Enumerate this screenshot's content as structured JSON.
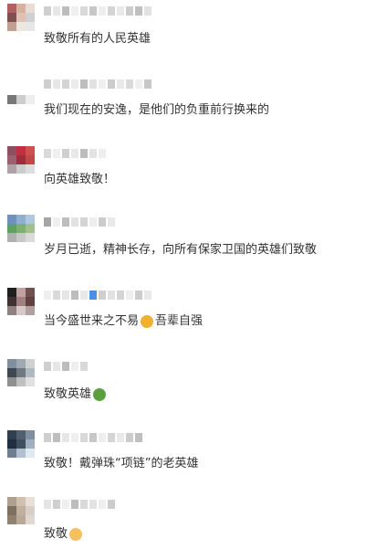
{
  "comments": [
    {
      "text": "致敬所有的人民英雄",
      "avatar": [
        "#b06060",
        "#d8b0a0",
        "#e8dcd4",
        "#805050",
        "#e0c0b0",
        "#d0d0d0",
        "#c0a090",
        "#ece8e0",
        "#e6e6e6"
      ],
      "name_blocks": [
        "#cfcfcf",
        "#e6e6e6",
        "#bdbdbd",
        "#efefef",
        "#d9d9d9",
        "#c7c7c7",
        "#eeeeee",
        "#d4d4d4",
        "#e9e9e9",
        "#cccccc",
        "#bfbfbf",
        "#e2e2e2"
      ]
    },
    {
      "text": "我们现在的安逸，是他们的负重前行换来的",
      "avatar": [
        "#ffffff",
        "#ffffff",
        "#ffffff",
        "#ffffff",
        "#ffffff",
        "#ffffff",
        "#777777",
        "#cccccc",
        "#eeeeee"
      ],
      "name_blocks": [
        "#cfcfcf",
        "#e6e6e6",
        "#d4d4d4",
        "#ececec",
        "#bdbdbd",
        "#e2e2e2",
        "#f0f0f0",
        "#cccccc",
        "#e9e9e9",
        "#d9d9d9",
        "#efefef",
        "#c7c7c7"
      ]
    },
    {
      "text": "向英雄致敬！",
      "avatar": [
        "#8a5060",
        "#c03040",
        "#d05050",
        "#9a6070",
        "#a02c3c",
        "#c04848",
        "#b0a0a8",
        "#cccccc",
        "#dddddd"
      ],
      "name_blocks": [
        "#d9d9d9",
        "#efefef",
        "#cfcfcf",
        "#e8e8e8",
        "#bdbdbd",
        "#e2e2e2",
        "#eeeeee"
      ]
    },
    {
      "text": "岁月已逝，精神长存，向所有保家卫国的英雄们致敬",
      "avatar": [
        "#7090c0",
        "#90b0d0",
        "#b0c8e0",
        "#60a060",
        "#80b070",
        "#a0c090",
        "#b0b0b0",
        "#c8c8c8",
        "#dadada"
      ],
      "name_blocks": [
        "#a6a6a6",
        "#efefef",
        "#bdbdbd",
        "#e2e2e2",
        "#d4d4d4",
        "#eeeeee",
        "#cccccc",
        "#e9e9e9"
      ]
    },
    {
      "text": "当今盛世来之不易",
      "text2": "吾辈自强",
      "emoji": "#f0b030",
      "avatar": [
        "#202020",
        "#c0a0a0",
        "#705050",
        "#403030",
        "#a08080",
        "#604040",
        "#908080",
        "#d8c8c8",
        "#b0a0a0"
      ],
      "name_blocks": [
        "#efefef",
        "#d9d9d9",
        "#e6e6e6",
        "#bdbdbd",
        "#e8e8e8",
        "#4a90e2",
        "#cfcfcf",
        "#e2e2e2",
        "#d4d4d4",
        "#eeeeee",
        "#cccccc",
        "#e9e9e9"
      ]
    },
    {
      "text": "致敬英雄",
      "emoji": "#5aa040",
      "avatar": [
        "#8090a0",
        "#a0a8b0",
        "#d0d0d0",
        "#404850",
        "#707880",
        "#b0b8c0",
        "#909090",
        "#c0c0c0",
        "#e0e0e0"
      ],
      "name_blocks": [
        "#cfcfcf",
        "#e6e6e6",
        "#bdbdbd",
        "#efefef",
        "#d9d9d9"
      ]
    },
    {
      "text": "致敬！戴弹珠“项链”的老英雄",
      "avatar": [
        "#304050",
        "#506070",
        "#8090a0",
        "#203040",
        "#405060",
        "#a0b0c0",
        "#708090",
        "#b0c0d0",
        "#e0e8f0"
      ],
      "name_blocks": [
        "#cfcfcf",
        "#bdbdbd",
        "#e6e6e6",
        "#efefef",
        "#d9d9d9",
        "#c7c7c7",
        "#eeeeee",
        "#d4d4d4",
        "#e9e9e9",
        "#cccccc",
        "#bfbfbf"
      ]
    },
    {
      "text": "致敬",
      "emoji": "#f5c060",
      "avatar": [
        "#b0a090",
        "#d0c0b0",
        "#e8e0d8",
        "#807060",
        "#c0b0a0",
        "#d8d0c8",
        "#908070",
        "#b8a898",
        "#e0d8d0"
      ],
      "name_blocks": [
        "#e6e6e6",
        "#cfcfcf",
        "#efefef",
        "#bdbdbd",
        "#d9d9d9",
        "#e2e2e2",
        "#eeeeee",
        "#cccccc"
      ]
    }
  ]
}
